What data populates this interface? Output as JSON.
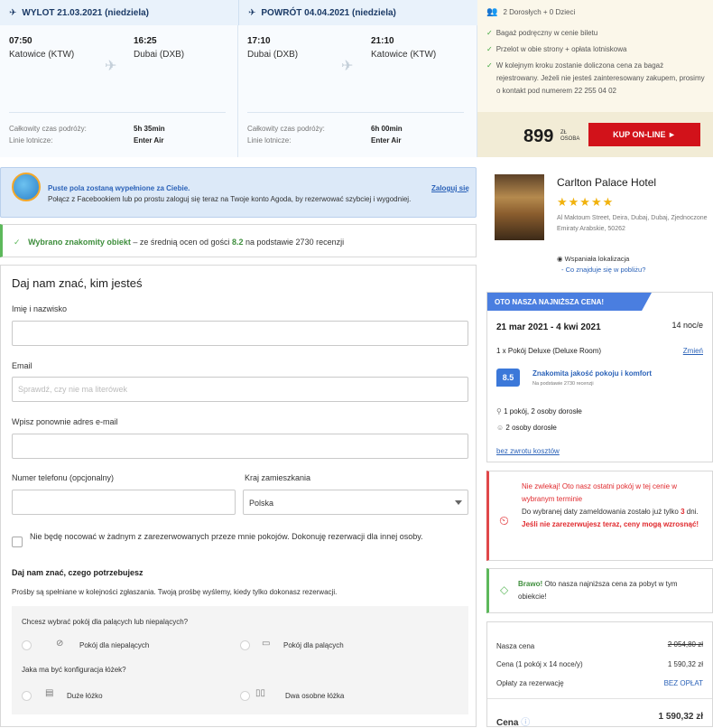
{
  "flight": {
    "outbound": {
      "header": "WYLOT 21.03.2021 (niedziela)",
      "dep_time": "07:50",
      "dep_city": "Katowice (KTW)",
      "arr_time": "16:25",
      "arr_city": "Dubai (DXB)",
      "duration_label": "Całkowity czas podróży:",
      "duration": "5h 35min",
      "airline_label": "Linie lotnicze:",
      "airline": "Enter Air"
    },
    "inbound": {
      "header": "POWRÓT 04.04.2021 (niedziela)",
      "dep_time": "17:10",
      "dep_city": "Dubai (DXB)",
      "arr_time": "21:10",
      "arr_city": "Katowice (KTW)",
      "duration_label": "Całkowity czas podróży:",
      "duration": "6h 00min",
      "airline_label": "Linie lotnicze:",
      "airline": "Enter Air"
    },
    "passengers": "2 Dorosłych + 0 Dzieci",
    "features": [
      "Bagaż podręczny w cenie biletu",
      "Przelot w obie strony + opłata lotniskowa",
      "W kolejnym kroku zostanie doliczona cena za bagaż rejestrowany. Jeżeli nie jesteś zainteresowany zakupem, prosimy o kontakt pod numerem 22 255 04 02"
    ],
    "price": "899",
    "price_currency": "ZŁ",
    "price_per": "OSOBA",
    "buy_label": "KUP ON-LINE ►"
  },
  "facebook_banner": {
    "title": "Puste pola zostaną wypełnione za Ciebie.",
    "text": "Połącz z Facebookiem lub po prostu zaloguj się teraz na Twoje konto Agoda, by rezerwować szybciej i wygodniej.",
    "login": "Zaloguj się"
  },
  "choice": {
    "check": "✓",
    "strong": "Wybrano znakomity obiekt",
    "middle": " – ze średnią ocen od gości ",
    "score": "8.2",
    "end": " na podstawie 2730 recenzji"
  },
  "form": {
    "title": "Daj nam znać, kim jesteś",
    "name_label": "Imię i nazwisko",
    "email_label": "Email",
    "email_placeholder": "Sprawdź, czy nie ma literówek",
    "email2_label": "Wpisz ponownie adres e-mail",
    "phone_label": "Numer telefonu (opcjonalny)",
    "country_label": "Kraj zamieszkania",
    "country_value": "Polska",
    "not_staying": "Nie będę nocować w żadnym z zarezerwowanych przeze mnie pokojów. Dokonuję rezerwacji dla innej osoby.",
    "needs_title": "Daj nam znać, czego potrzebujesz",
    "needs_text": "Prośby są spełniane w kolejności zgłaszania. Twoją prośbę wyślemy, kiedy tylko dokonasz rezerwacji.",
    "smoking_q": "Chcesz wybrać pokój dla palących lub niepalących?",
    "non_smoking": "Pokój dla niepalących",
    "smoking": "Pokój dla palących",
    "beds_q": "Jaka ma być konfiguracja łóżek?",
    "double_bed": "Duże łóżko",
    "twin_beds": "Dwa osobne łóżka"
  },
  "hotel": {
    "name": "Carlton Palace Hotel",
    "stars": "★★★★★",
    "address": "Al Maktoum Street, Deira, Dubaj, Dubaj, Zjednoczone Emiraty Arabskie, 50262",
    "location": "Wspaniała lokalizacja",
    "nearby": "- Co znajduje się w pobliżu?"
  },
  "lowest": {
    "banner": "OTO NASZA NAJNIŻSZA CENA!",
    "dates": "21 mar 2021 - 4 kwi 2021",
    "nights": "14 noc/e",
    "room": "1 x Pokój Deluxe (Deluxe Room)",
    "change": "Zmień",
    "score": "8.5",
    "score_text": "Znakomita jakość pokoju i komfort",
    "score_sub": "Na podstawie 2730 recenzji",
    "occupancy": "1 pokój, 2 osoby dorosłe",
    "adults": "2 osoby dorosłe",
    "cancel": "bez zwrotu kosztów"
  },
  "urgent": {
    "title": "Nie zwlekaj! Oto nasz ostatni pokój w tej cenie w wybranym terminie",
    "text_a": "Do wybranej daty zameldowania zostało już tylko ",
    "days": "3",
    "text_b": " dni. ",
    "text_c": "Jeśli nie zarezerwujesz teraz, ceny mogą wzrosnąć!"
  },
  "bravo": {
    "strong": "Brawo!",
    "text": " Oto nasza najniższa cena za pobyt w tym obiekcie!"
  },
  "breakdown": {
    "our_price_label": "Nasza cena",
    "our_price": "2 054,80 zł",
    "price_label": "Cena (1 pokój x 14 noce/y)",
    "price": "1 590,32 zł",
    "fee_label": "Opłaty za rezerwację",
    "fee": "BEZ OPŁAT",
    "total_label": "Cena",
    "total": "1 590,32 zł"
  },
  "colors": {
    "brand_red": "#d2121a",
    "link_blue": "#2b62b8",
    "success_green": "#3e8e3c",
    "alert_red": "#e02a2e"
  }
}
